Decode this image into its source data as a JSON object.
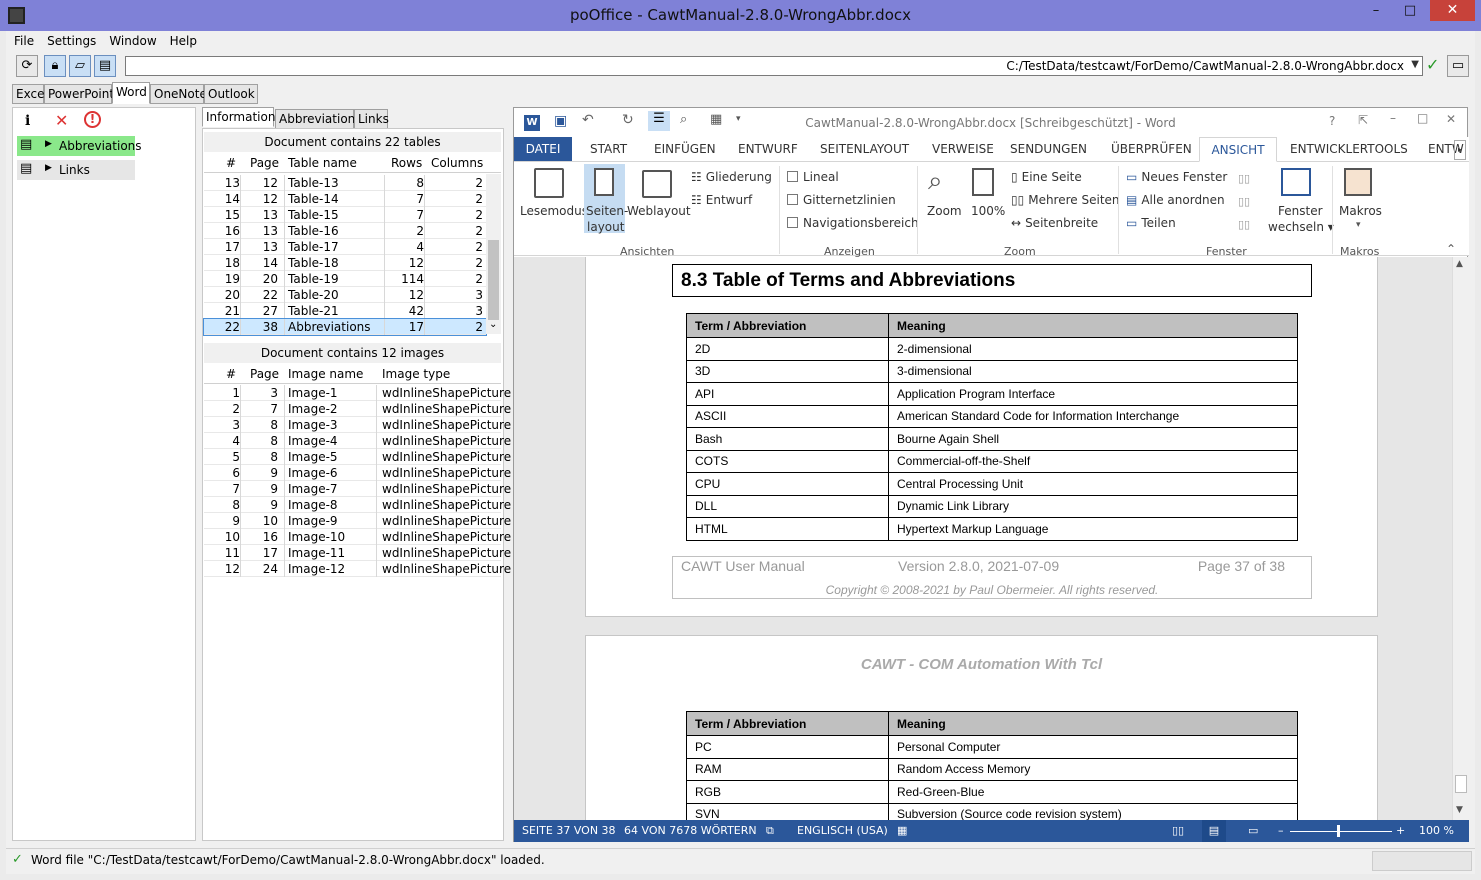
{
  "window": {
    "title": "poOffice - CawtManual-2.8.0-WrongAbbr.docx",
    "min": "–",
    "max": "□",
    "close": "✕"
  },
  "menu": [
    "File",
    "Settings",
    "Window",
    "Help"
  ],
  "toolbar": {
    "path": "C:/TestData/testcawt/ForDemo/CawtManual-2.8.0-WrongAbbr.docx"
  },
  "apptabs": [
    "Excel",
    "PowerPoint",
    "Word",
    "OneNote",
    "Outlook"
  ],
  "left": {
    "items": [
      "Abbreviations",
      "Links"
    ]
  },
  "mid": {
    "tabs": [
      "Information",
      "Abbreviations",
      "Links"
    ],
    "tables_caption": "Document contains 22 tables",
    "tables_headers": [
      "#",
      "Page",
      "Table name",
      "Rows",
      "Columns"
    ],
    "tables": [
      [
        "13",
        "12",
        "Table-13",
        "8",
        "2"
      ],
      [
        "14",
        "12",
        "Table-14",
        "7",
        "2"
      ],
      [
        "15",
        "13",
        "Table-15",
        "7",
        "2"
      ],
      [
        "16",
        "13",
        "Table-16",
        "2",
        "2"
      ],
      [
        "17",
        "13",
        "Table-17",
        "4",
        "2"
      ],
      [
        "18",
        "14",
        "Table-18",
        "12",
        "2"
      ],
      [
        "19",
        "20",
        "Table-19",
        "114",
        "2"
      ],
      [
        "20",
        "22",
        "Table-20",
        "12",
        "3"
      ],
      [
        "21",
        "27",
        "Table-21",
        "42",
        "3"
      ],
      [
        "22",
        "38",
        "Abbreviations",
        "17",
        "2"
      ]
    ],
    "images_caption": "Document contains 12 images",
    "images_headers": [
      "#",
      "Page",
      "Image name",
      "Image type"
    ],
    "images": [
      [
        "1",
        "3",
        "Image-1",
        "wdInlineShapePicture"
      ],
      [
        "2",
        "7",
        "Image-2",
        "wdInlineShapePicture"
      ],
      [
        "3",
        "8",
        "Image-3",
        "wdInlineShapePicture"
      ],
      [
        "4",
        "8",
        "Image-4",
        "wdInlineShapePicture"
      ],
      [
        "5",
        "8",
        "Image-5",
        "wdInlineShapePicture"
      ],
      [
        "6",
        "9",
        "Image-6",
        "wdInlineShapePicture"
      ],
      [
        "7",
        "9",
        "Image-7",
        "wdInlineShapePicture"
      ],
      [
        "8",
        "9",
        "Image-8",
        "wdInlineShapePicture"
      ],
      [
        "9",
        "10",
        "Image-9",
        "wdInlineShapePicture"
      ],
      [
        "10",
        "16",
        "Image-10",
        "wdInlineShapePicture"
      ],
      [
        "11",
        "17",
        "Image-11",
        "wdInlineShapePicture"
      ],
      [
        "12",
        "24",
        "Image-12",
        "wdInlineShapePicture"
      ]
    ]
  },
  "word": {
    "title": "CawtManual-2.8.0-WrongAbbr.docx [Schreibgeschützt] - Word",
    "help": "?",
    "tabs": [
      "DATEI",
      "START",
      "EINFÜGEN",
      "ENTWURF",
      "SEITENLAYOUT",
      "VERWEISE",
      "SENDUNGEN",
      "ÜBERPRÜFEN",
      "ANSICHT",
      "ENTWICKLERTOOLS",
      "ENTW"
    ],
    "ribbon": {
      "lesemodus": "Lesemodus",
      "seiten1": "Seiten-",
      "seiten2": "layout",
      "weblayout": "Weblayout",
      "gliederung": "Gliederung",
      "entwurf": "Entwurf",
      "g_ansichten": "Ansichten",
      "lineal": "Lineal",
      "gitter": "Gitternetzlinien",
      "navi": "Navigationsbereich",
      "g_anzeigen": "Anzeigen",
      "zoom": "Zoom",
      "hundred": "100%",
      "eine": "Eine Seite",
      "mehrere": "Mehrere Seiten",
      "breite": "Seitenbreite",
      "g_zoom": "Zoom",
      "neues": "Neues Fenster",
      "alle": "Alle anordnen",
      "teilen": "Teilen",
      "fenster1": "Fenster",
      "fenster2": "wechseln",
      "g_fenster": "Fenster",
      "makros": "Makros",
      "g_makros": "Makros"
    },
    "heading": "8.3  Table of Terms and Abbreviations",
    "table_head": [
      "Term / Abbreviation",
      "Meaning"
    ],
    "table1": [
      [
        "2D",
        "2-dimensional"
      ],
      [
        "3D",
        "3-dimensional"
      ],
      [
        "API",
        "Application Program Interface"
      ],
      [
        "ASCII",
        "American Standard Code for Information Interchange"
      ],
      [
        "Bash",
        "Bourne Again Shell"
      ],
      [
        "COTS",
        "Commercial-off-the-Shelf"
      ],
      [
        "CPU",
        "Central Processing Unit"
      ],
      [
        "DLL",
        "Dynamic Link Library"
      ],
      [
        "HTML",
        "Hypertext Markup Language"
      ]
    ],
    "footer": {
      "left": "CAWT User Manual",
      "mid": "Version 2.8.0, 2021-07-09",
      "right": "Page 37 of 38",
      "copy": "Copyright © 2008-2021 by Paul Obermeier. All rights reserved."
    },
    "header2": "CAWT - COM Automation With Tcl",
    "table2": [
      [
        "PC",
        "Personal Computer"
      ],
      [
        "RAM",
        "Random Access Memory"
      ],
      [
        "RGB",
        "Red-Green-Blue"
      ],
      [
        "SVN",
        "Subversion (Source code revision system)"
      ]
    ],
    "status": {
      "page": "SEITE 37 VON 38",
      "words": "64 VON 7678 WÖRTERN",
      "lang": "ENGLISCH (USA)",
      "zoom": "100 %"
    }
  },
  "statusbar": {
    "message": "Word file \"C:/TestData/testcawt/ForDemo/CawtManual-2.8.0-WrongAbbr.docx\" loaded."
  }
}
